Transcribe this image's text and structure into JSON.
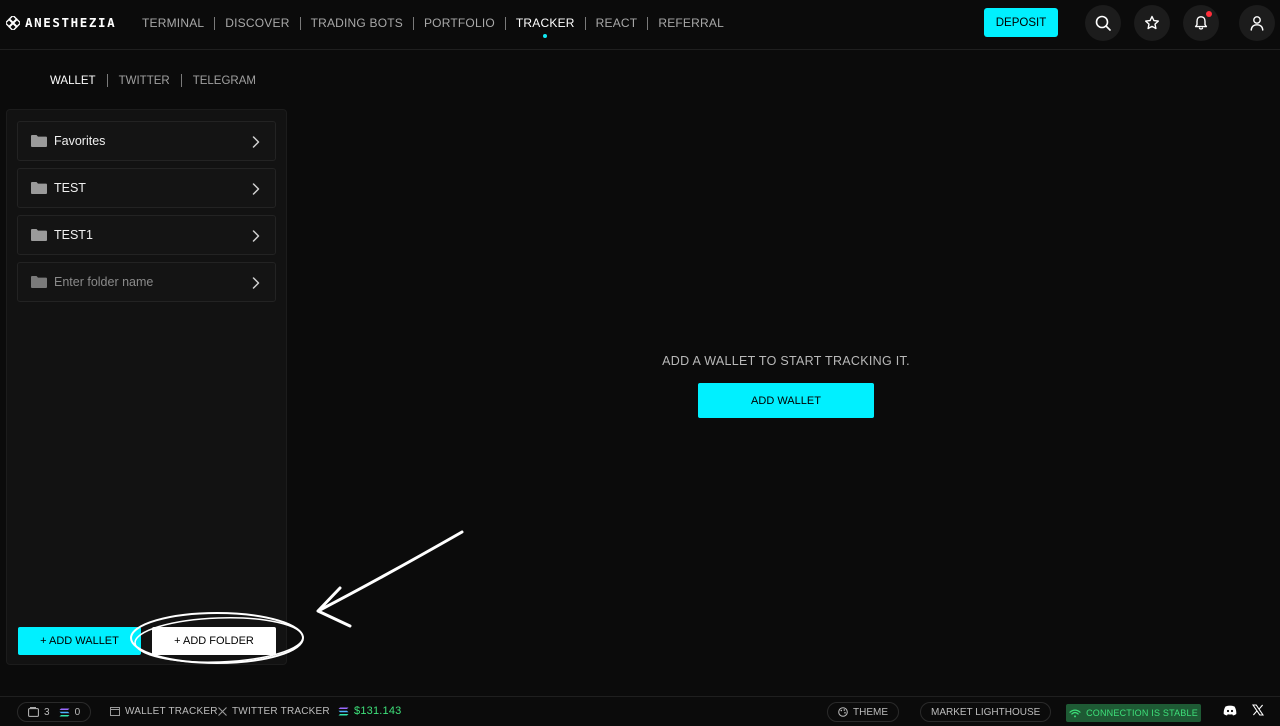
{
  "app": {
    "name": "ANESTHEZIA"
  },
  "nav": {
    "items": [
      {
        "label": "TERMINAL"
      },
      {
        "label": "DISCOVER"
      },
      {
        "label": "TRADING BOTS"
      },
      {
        "label": "PORTFOLIO"
      },
      {
        "label": "TRACKER",
        "active": true
      },
      {
        "label": "REACT"
      },
      {
        "label": "REFERRAL"
      }
    ],
    "deposit_label": "DEPOSIT",
    "icons": [
      "search-icon",
      "star-icon",
      "bell-icon",
      "user-icon"
    ],
    "has_notification": true
  },
  "subtabs": [
    {
      "label": "WALLET",
      "active": true
    },
    {
      "label": "TWITTER"
    },
    {
      "label": "TELEGRAM"
    }
  ],
  "sidebar": {
    "folders": [
      {
        "label": "Favorites"
      },
      {
        "label": "TEST"
      },
      {
        "label": "TEST1"
      }
    ],
    "new_folder_placeholder": "Enter folder name",
    "add_wallet_label": "+ ADD WALLET",
    "add_folder_label": "+ ADD FOLDER"
  },
  "main": {
    "empty_message": "ADD A WALLET TO START TRACKING IT.",
    "add_wallet_label": "ADD WALLET"
  },
  "footer": {
    "wallet_count": "3",
    "sol_count": "0",
    "wallet_tracker_label": "WALLET TRACKER",
    "twitter_tracker_label": "TWITTER TRACKER",
    "sol_price": "$131.143",
    "theme_label": "THEME",
    "market_lighthouse_label": "MARKET LIGHTHOUSE",
    "connection_label": "CONNECTION IS STABLE"
  },
  "colors": {
    "accent": "#00f0ff",
    "background": "#0b0b0b",
    "success": "#3ee07a",
    "notification": "#ff2d3a"
  }
}
